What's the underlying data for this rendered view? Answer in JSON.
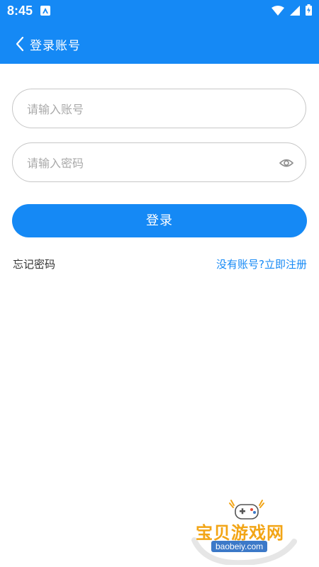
{
  "status_bar": {
    "time": "8:45",
    "icons": [
      "app-notification-icon",
      "wifi-icon",
      "signal-icon",
      "battery-icon"
    ]
  },
  "header": {
    "back_icon": "chevron-left-icon",
    "title": "登录账号"
  },
  "form": {
    "account": {
      "placeholder": "请输入账号",
      "value": ""
    },
    "password": {
      "placeholder": "请输入密码",
      "value": "",
      "toggle_icon": "eye-icon"
    },
    "submit_label": "登录"
  },
  "links": {
    "forgot_password": "忘记密码",
    "register": "没有账号?立即注册"
  },
  "watermark": {
    "title": "宝贝游戏网",
    "domain": "baobeiy.com"
  },
  "colors": {
    "primary": "#1589f5",
    "text": "#333333",
    "placeholder": "#a9a9a9",
    "border": "#c7c7c7",
    "watermark_gold": "#f2a516",
    "watermark_blue": "#3c79c8"
  }
}
